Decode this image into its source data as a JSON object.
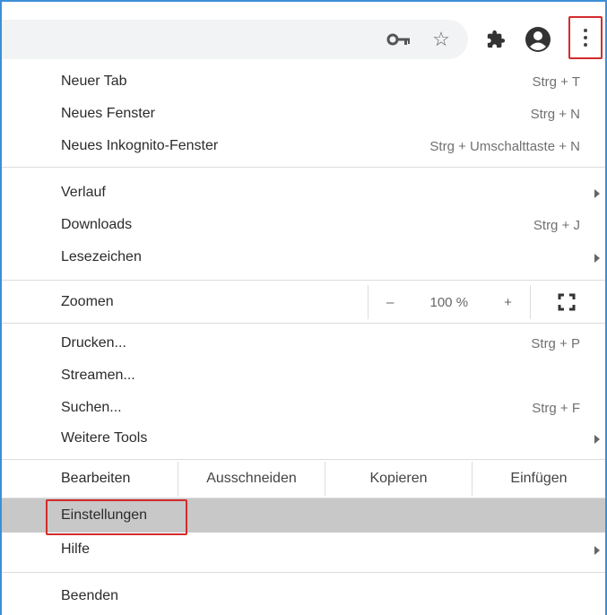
{
  "toolbar": {
    "icons": [
      "key-icon",
      "star-icon",
      "puzzle-icon",
      "account-icon",
      "three-dots-menu-icon"
    ],
    "highlight_color": "#d42b2b"
  },
  "menu": {
    "new_tab": {
      "label": "Neuer Tab",
      "shortcut": "Strg + T"
    },
    "new_window": {
      "label": "Neues Fenster",
      "shortcut": "Strg + N"
    },
    "incognito": {
      "label": "Neues Inkognito-Fenster",
      "shortcut": "Strg + Umschalttaste + N"
    },
    "history": {
      "label": "Verlauf"
    },
    "downloads": {
      "label": "Downloads",
      "shortcut": "Strg + J"
    },
    "bookmarks": {
      "label": "Lesezeichen"
    },
    "zoom": {
      "label": "Zoomen",
      "minus": "–",
      "value": "100 %",
      "plus": "+"
    },
    "print": {
      "label": "Drucken...",
      "shortcut": "Strg + P"
    },
    "cast": {
      "label": "Streamen..."
    },
    "find": {
      "label": "Suchen...",
      "shortcut": "Strg + F"
    },
    "more_tools": {
      "label": "Weitere Tools"
    },
    "edit": {
      "label": "Bearbeiten",
      "cut": "Ausschneiden",
      "copy": "Kopieren",
      "paste": "Einfügen"
    },
    "settings": {
      "label": "Einstellungen"
    },
    "help": {
      "label": "Hilfe"
    },
    "exit": {
      "label": "Beenden"
    }
  }
}
